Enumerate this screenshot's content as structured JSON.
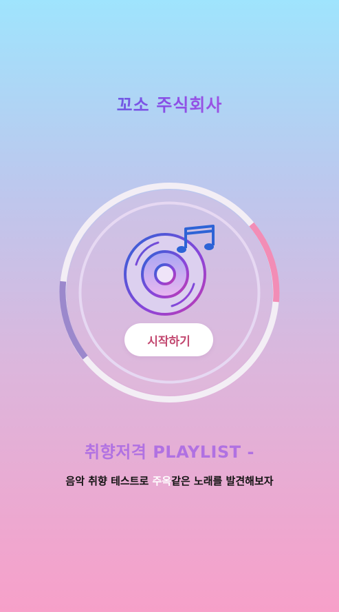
{
  "header": {
    "company_name": "꼬소 주식회사"
  },
  "hero": {
    "icon": "music-disc-icon",
    "start_button_label": "시작하기"
  },
  "footer": {
    "subtitle": "취향저격 PLAYLIST -",
    "description_before": "음악 취향 테스트로 ",
    "description_highlight": "주옥",
    "description_after": "같은 노래를 발견해보자"
  },
  "colors": {
    "bg_top": "#9fe4fd",
    "bg_bottom": "#f7a0c9",
    "accent_pink": "#f08bb4",
    "accent_purple": "#9b86cc",
    "button_text": "#c2476f",
    "subtitle": "#b071e2"
  }
}
